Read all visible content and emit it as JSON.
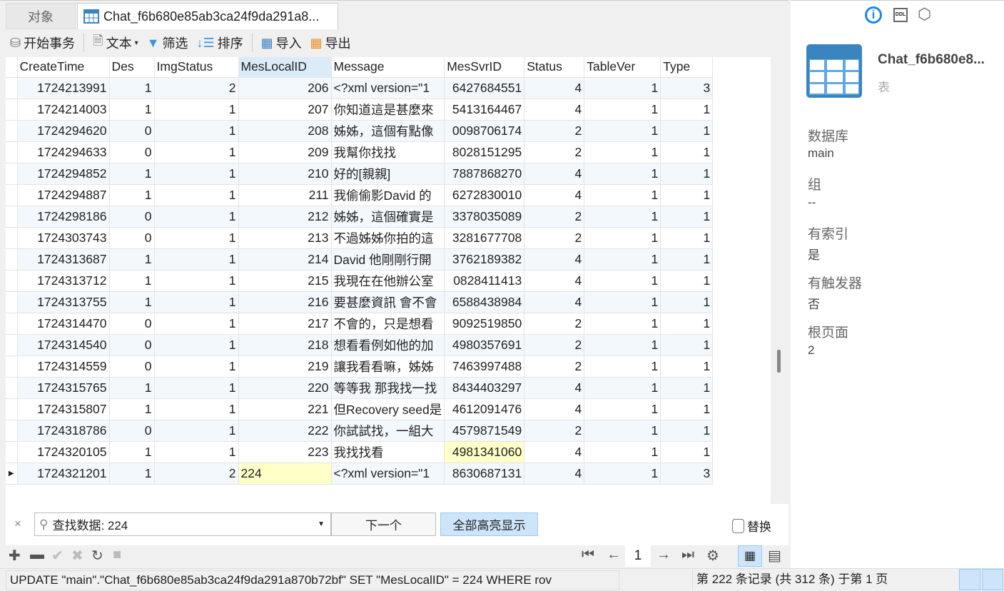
{
  "tabs": {
    "objects": "对象",
    "chat": "Chat_f6b680e85ab3ca24f9da291a8..."
  },
  "toolbar": {
    "begin": "开始事务",
    "text": "文本",
    "filter": "筛选",
    "sort": "排序",
    "import": "导入",
    "export": "导出"
  },
  "columns": [
    "CreateTime",
    "Des",
    "ImgStatus",
    "MesLocalID",
    "Message",
    "MesSvrID",
    "Status",
    "TableVer",
    "Type"
  ],
  "rows": [
    [
      "1724213991",
      "1",
      "2",
      "206",
      "<?xml version=\"1",
      "6427684551",
      "4",
      "1",
      "3"
    ],
    [
      "1724214003",
      "1",
      "1",
      "207",
      "你知道這是甚麼來",
      "5413164467",
      "4",
      "1",
      "1"
    ],
    [
      "1724294620",
      "0",
      "1",
      "208",
      "姊姊，這個有點像",
      "0098706174",
      "2",
      "1",
      "1"
    ],
    [
      "1724294633",
      "0",
      "1",
      "209",
      "我幫你找找",
      "8028151295",
      "2",
      "1",
      "1"
    ],
    [
      "1724294852",
      "1",
      "1",
      "210",
      "好的[親親]",
      "7887868270",
      "4",
      "1",
      "1"
    ],
    [
      "1724294887",
      "1",
      "1",
      "211",
      "我偷偷影David 的",
      "6272830010",
      "4",
      "1",
      "1"
    ],
    [
      "1724298186",
      "0",
      "1",
      "212",
      "姊姊，這個確實是",
      "3378035089",
      "2",
      "1",
      "1"
    ],
    [
      "1724303743",
      "0",
      "1",
      "213",
      "不過姊姊你拍的這",
      "3281677708",
      "2",
      "1",
      "1"
    ],
    [
      "1724313687",
      "1",
      "1",
      "214",
      "David 他剛剛行開",
      "3762189382",
      "4",
      "1",
      "1"
    ],
    [
      "1724313712",
      "1",
      "1",
      "215",
      "我現在在他辦公室",
      "0828411413",
      "4",
      "1",
      "1"
    ],
    [
      "1724313755",
      "1",
      "1",
      "216",
      "要甚麼資訊 會不會",
      "6588438984",
      "4",
      "1",
      "1"
    ],
    [
      "1724314470",
      "0",
      "1",
      "217",
      "不會的，只是想看",
      "9092519850",
      "2",
      "1",
      "1"
    ],
    [
      "1724314540",
      "0",
      "1",
      "218",
      "想看看例如他的加",
      "4980357691",
      "2",
      "1",
      "1"
    ],
    [
      "1724314559",
      "0",
      "1",
      "219",
      "讓我看看嘛，姊姊",
      "7463997488",
      "2",
      "1",
      "1"
    ],
    [
      "1724315765",
      "1",
      "1",
      "220",
      "等等我 那我找一找",
      "8434403297",
      "4",
      "1",
      "1"
    ],
    [
      "1724315807",
      "1",
      "1",
      "221",
      "但Recovery seed是",
      "4612091476",
      "4",
      "1",
      "1"
    ],
    [
      "1724318786",
      "0",
      "1",
      "222",
      "你試試找，一組大",
      "4579871549",
      "2",
      "1",
      "1"
    ],
    [
      "1724320105",
      "1",
      "1",
      "223",
      "我找找看",
      "4981341060",
      "4",
      "1",
      "1"
    ],
    [
      "1724321201",
      "1",
      "2",
      "224",
      "<?xml version=\"1",
      "8630687131",
      "4",
      "1",
      "3"
    ]
  ],
  "find": {
    "value": "查找数据: 224",
    "next": "下一个",
    "highlight_all": "全部高亮显示",
    "replace": "替换"
  },
  "pager": {
    "page": "1"
  },
  "status": {
    "sql": "UPDATE \"main\".\"Chat_f6b680e85ab3ca24f9da291a870b72bf\" SET \"MesLocalID\" = 224 WHERE rov",
    "record": "第 222 条记录 (共 312 条) 于第 1 页"
  },
  "panel": {
    "title": "Chat_f6b680e8...",
    "type": "表",
    "db_label": "数据库",
    "db": "main",
    "group_label": "组",
    "group": "--",
    "index_label": "有索引",
    "index": "是",
    "trigger_label": "有触发器",
    "trigger": "否",
    "root_label": "根页面",
    "root": "2",
    "ddl": "DDL"
  },
  "colors": {
    "accent": "#1e88e5",
    "highlight": "#ffffc8"
  }
}
